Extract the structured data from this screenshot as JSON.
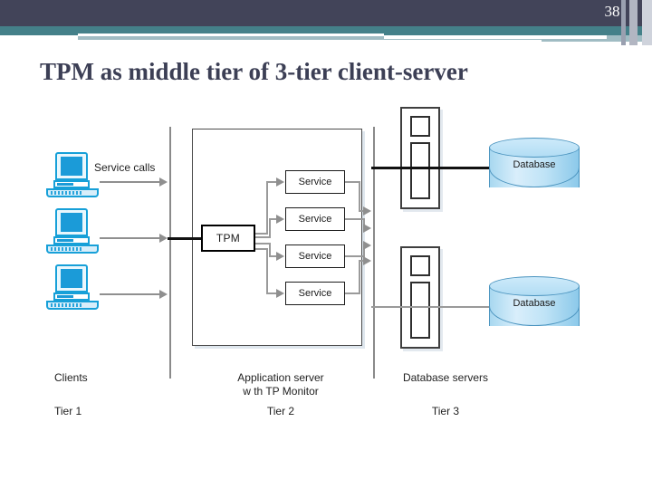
{
  "slide": {
    "number": "38",
    "title": "TPM as middle tier of 3-tier client-server"
  },
  "diagram": {
    "service_calls_label": "Service calls",
    "tpm_label": "TPM",
    "services": [
      {
        "label": "Service"
      },
      {
        "label": "Service"
      },
      {
        "label": "Service"
      },
      {
        "label": "Service"
      }
    ],
    "databases": [
      {
        "label": "Database"
      },
      {
        "label": "Database"
      }
    ],
    "tiers": [
      {
        "caption": "Clients",
        "name": "Tier 1"
      },
      {
        "caption": "Application server\nw th TP Monitor",
        "name": "Tier 2"
      },
      {
        "caption": "Database servers",
        "name": "Tier 3"
      }
    ]
  },
  "colors": {
    "header_dark": "#424459",
    "header_teal": "#448089",
    "header_pale": "#a0bcc3",
    "title_text": "#3c3f55",
    "client_blue": "#1b9bd8",
    "database_blue": "#b2ddf4"
  }
}
